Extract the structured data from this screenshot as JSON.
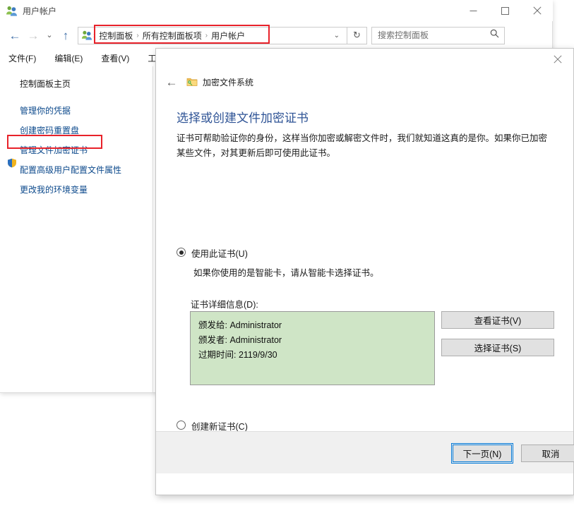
{
  "window": {
    "title": "用户帐户",
    "icon": "user-accounts-icon",
    "minimize_label": "最小化",
    "maximize_label": "最大化",
    "close_label": "关闭"
  },
  "address_bar": {
    "back_label": "←",
    "forward_label": "→",
    "recent_label": "⌄",
    "up_label": "↑",
    "breadcrumb_icon": "user-accounts-icon",
    "crumbs": [
      "控制面板",
      "所有控制面板项",
      "用户帐户"
    ],
    "separator": "›",
    "dropdown": "⌄",
    "refresh": "↻",
    "highlighted": true
  },
  "search": {
    "placeholder": "搜索控制面板",
    "value": "",
    "icon": "search-icon"
  },
  "menu": {
    "items": [
      "文件(F)",
      "编辑(E)",
      "查看(V)",
      "工具(T)"
    ]
  },
  "sidebar": {
    "home": "控制面板主页",
    "items": [
      {
        "label": "管理你的凭据",
        "shield": false,
        "highlighted": false
      },
      {
        "label": "创建密码重置盘",
        "shield": false,
        "highlighted": false
      },
      {
        "label": "管理文件加密证书",
        "shield": false,
        "highlighted": true
      },
      {
        "label": "配置高级用户配置文件属性",
        "shield": true,
        "highlighted": false
      },
      {
        "label": "更改我的环境变量",
        "shield": false,
        "highlighted": false
      }
    ]
  },
  "dialog": {
    "close_label": "✕",
    "back_label": "←",
    "header_icon": "encrypted-folder-key-icon",
    "header_title": "加密文件系统",
    "heading": "选择或创建文件加密证书",
    "description": "证书可帮助验证你的身份，这样当你加密或解密文件时，我们就知道这真的是你。如果你已加密某些文件，对其更新后即可使用此证书。",
    "options": [
      {
        "label": "使用此证书(U)",
        "selected": true
      },
      {
        "label": "创建新证书(C)",
        "selected": false
      }
    ],
    "use_cert_hint": "如果你使用的是智能卡，请从智能卡选择证书。",
    "cert_details_label": "证书详细信息(D):",
    "cert_details": [
      "颁发给: Administrator",
      "颁发者: Administrator",
      "过期时间: 2119/9/30"
    ],
    "cert_box_color": "#cfe5c6",
    "view_cert_button": "查看证书(V)",
    "select_cert_button": "选择证书(S)",
    "next_button": "下一页(N)",
    "cancel_button": "取消"
  },
  "annotation": {
    "accent_color": "#e8222a"
  }
}
